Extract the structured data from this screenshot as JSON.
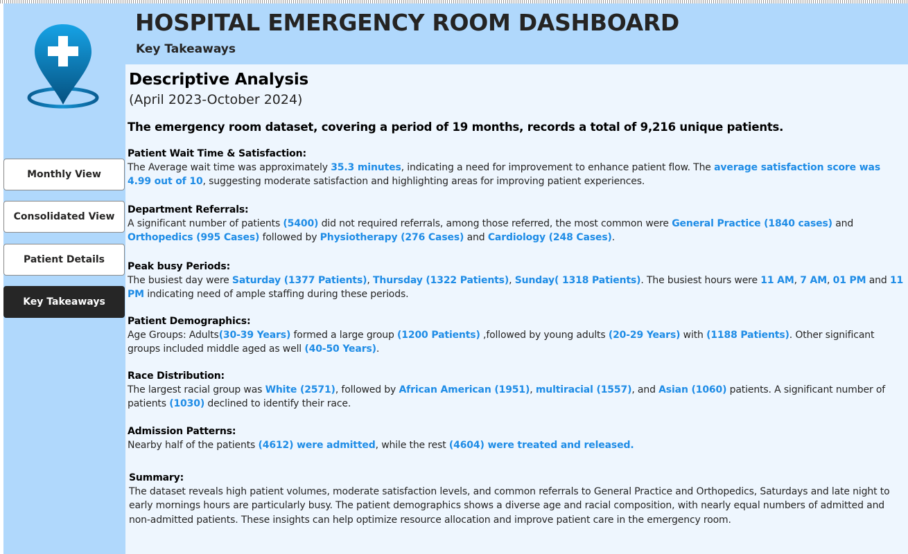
{
  "header": {
    "title": "HOSPITAL EMERGENCY ROOM DASHBOARD",
    "subtitle": "Key Takeaways"
  },
  "nav": {
    "items": [
      {
        "label": "Monthly View",
        "active": false
      },
      {
        "label": "Consolidated View",
        "active": false
      },
      {
        "label": "Patient Details",
        "active": false
      },
      {
        "label": "Key Takeaways",
        "active": true
      }
    ]
  },
  "logo": {
    "icon": "hospital-location-pin-icon",
    "color": "#0a8fd6"
  },
  "colors": {
    "sidebar": "#b0d8fc",
    "content_bg": "#eef6fe",
    "highlight": "#1e8ce6",
    "active_nav": "#262626"
  },
  "content": {
    "title": "Descriptive Analysis",
    "period": "(April 2023-October 2024)",
    "intro": "The emergency room dataset, covering a period of 19 months, records a total of 9,216 unique patients.",
    "sections": [
      {
        "heading": "Patient Wait Time & Satisfaction:",
        "parts": [
          {
            "t": "The Average wait time was approximately "
          },
          {
            "t": "35.3 minutes",
            "hl": true
          },
          {
            "t": ", indicating a need for improvement to enhance patient flow. The "
          },
          {
            "t": "average satisfaction score was 4.99 out of 10",
            "hl": true
          },
          {
            "t": ", suggesting moderate satisfaction and highlighting areas for improving patient experiences."
          }
        ]
      },
      {
        "heading": "Department Referrals:",
        "parts": [
          {
            "t": "A significant number of patients "
          },
          {
            "t": "(5400)",
            "hl": true
          },
          {
            "t": " did not required referrals, among those referred, the most common were "
          },
          {
            "t": "General Practice (1840 cases)",
            "hl": true
          },
          {
            "t": " and "
          },
          {
            "t": "Orthopedics (995 Cases)",
            "hl": true
          },
          {
            "t": " followed by "
          },
          {
            "t": "Physiotherapy (276 Cases)",
            "hl": true
          },
          {
            "t": " and "
          },
          {
            "t": "Cardiology (248 Cases)",
            "hl": true
          },
          {
            "t": "."
          }
        ]
      },
      {
        "heading": "Peak busy Periods:",
        "parts": [
          {
            "t": "The busiest day were "
          },
          {
            "t": "Saturday (1377 Patients)",
            "hl": true
          },
          {
            "t": ", "
          },
          {
            "t": "Thursday (1322 Patients)",
            "hl": true
          },
          {
            "t": ", "
          },
          {
            "t": "Sunday( 1318 Patients)",
            "hl": true
          },
          {
            "t": ". The busiest hours were "
          },
          {
            "t": "11 AM",
            "hl": true
          },
          {
            "t": ", "
          },
          {
            "t": "7 AM",
            "hl": true
          },
          {
            "t": ", "
          },
          {
            "t": "01 PM",
            "hl": true
          },
          {
            "t": " and "
          },
          {
            "t": "11 PM",
            "hl": true
          },
          {
            "t": " indicating need of ample staffing during these periods."
          }
        ]
      },
      {
        "heading": "Patient Demographics:",
        "parts": [
          {
            "t": "Age Groups: Adults"
          },
          {
            "t": "(30-39 Years)",
            "hl": true
          },
          {
            "t": " formed a large group "
          },
          {
            "t": "(1200 Patients)",
            "hl": true
          },
          {
            "t": " ,followed by young adults "
          },
          {
            "t": "(20-29 Years)",
            "hl": true
          },
          {
            "t": " with "
          },
          {
            "t": "(1188 Patients)",
            "hl": true
          },
          {
            "t": ". Other significant groups included middle aged as well "
          },
          {
            "t": "(40-50 Years)",
            "hl": true
          },
          {
            "t": "."
          }
        ]
      },
      {
        "heading": "Race Distribution:",
        "parts": [
          {
            "t": "The largest racial group was "
          },
          {
            "t": "White (2571)",
            "hl": true
          },
          {
            "t": ", followed by "
          },
          {
            "t": "African American (1951)",
            "hl": true
          },
          {
            "t": ", "
          },
          {
            "t": "multiracial (1557)",
            "hl": true
          },
          {
            "t": ", and "
          },
          {
            "t": "Asian (1060)",
            "hl": true
          },
          {
            "t": " patients. A significant number of patients "
          },
          {
            "t": "(1030)",
            "hl": true
          },
          {
            "t": " declined to identify their race."
          }
        ]
      },
      {
        "heading": "Admission Patterns:",
        "parts": [
          {
            "t": "Nearby half of the patients "
          },
          {
            "t": "(4612) were admitted",
            "hl": true
          },
          {
            "t": ", while the rest "
          },
          {
            "t": "(4604) were treated and released.",
            "hl": true
          }
        ]
      },
      {
        "heading": "Summary:",
        "parts": [
          {
            "t": "The dataset reveals high patient volumes, moderate satisfaction levels, and common referrals to General Practice and Orthopedics, Saturdays and late night to early mornings hours are particularly busy. The patient demographics shows a diverse age and racial composition, with nearly equal numbers of admitted and non-admitted patients. These insights can help optimize resource allocation and improve patient care in the emergency room."
          }
        ]
      }
    ]
  }
}
